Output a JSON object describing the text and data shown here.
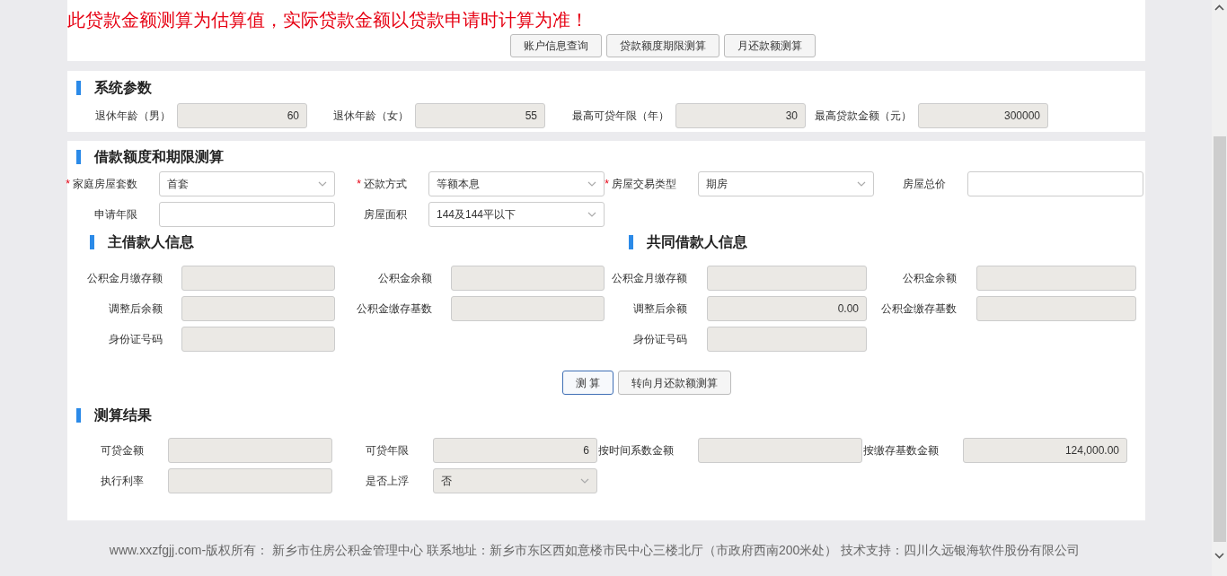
{
  "notice": "此贷款金额测算为估算值，实际贷款金额以贷款申请时计算为准！",
  "top_buttons": [
    "账户信息查询",
    "贷款额度期限测算",
    "月还款额测算"
  ],
  "system_params": {
    "title": "系统参数",
    "fields": [
      {
        "label": "退休年龄（男）",
        "kind": "input",
        "disabled": true,
        "value": "60"
      },
      {
        "label": "退休年龄（女）",
        "kind": "input",
        "disabled": true,
        "value": "55"
      },
      {
        "label": "最高可贷年限（年）",
        "kind": "input",
        "disabled": true,
        "value": "30"
      },
      {
        "label": "最高贷款金额（元）",
        "kind": "input",
        "disabled": true,
        "value": "300000"
      }
    ]
  },
  "loan_calc": {
    "title": "借款额度和期限测算",
    "fields": [
      {
        "label": "家庭房屋套数",
        "required_mark": "*",
        "kind": "select",
        "disabled": false,
        "value": "首套"
      },
      {
        "label": "还款方式",
        "required_mark": "*",
        "kind": "select",
        "disabled": false,
        "value": "等额本息"
      },
      {
        "label": "房屋交易类型",
        "required_mark": "*",
        "kind": "select",
        "disabled": false,
        "value": "期房"
      },
      {
        "label": "房屋总价",
        "kind": "input",
        "disabled": false
      },
      {
        "label": "申请年限",
        "kind": "input",
        "disabled": false
      },
      {
        "label": "房屋面积",
        "kind": "select",
        "disabled": false,
        "value": "144及144平以下"
      }
    ]
  },
  "main_borrower": {
    "title": "主借款人信息",
    "fields": [
      {
        "label": "公积金月缴存额",
        "kind": "input",
        "disabled": true
      },
      {
        "label": "公积金余额",
        "kind": "input",
        "disabled": true
      },
      {
        "label": "调整后余额",
        "kind": "input",
        "disabled": true
      },
      {
        "label": "公积金缴存基数",
        "kind": "input",
        "disabled": true
      },
      {
        "label": "身份证号码",
        "kind": "input",
        "disabled": true
      }
    ]
  },
  "co_borrower": {
    "title": "共同借款人信息",
    "fields": [
      {
        "label": "公积金月缴存额",
        "kind": "input",
        "disabled": true
      },
      {
        "label": "公积金余额",
        "kind": "input",
        "disabled": true
      },
      {
        "label": "调整后余额",
        "kind": "input",
        "disabled": true,
        "value": "0.00"
      },
      {
        "label": "公积金缴存基数",
        "kind": "input",
        "disabled": true
      },
      {
        "label": "身份证号码",
        "kind": "input",
        "disabled": true
      }
    ]
  },
  "actions": [
    {
      "label": "测 算",
      "focused": true
    },
    {
      "label": "转向月还款额测算",
      "focused": false
    }
  ],
  "results": {
    "title": "测算结果",
    "fields": [
      {
        "label": "可贷金额",
        "kind": "input",
        "disabled": true
      },
      {
        "label": "可贷年限",
        "kind": "input",
        "disabled": true,
        "value": "6"
      },
      {
        "label": "按时间系数金额",
        "kind": "input",
        "disabled": true
      },
      {
        "label": "按缴存基数金额",
        "kind": "input",
        "disabled": true,
        "value": "124,000.00"
      },
      {
        "label": "执行利率",
        "kind": "input",
        "disabled": true
      },
      {
        "label": "是否上浮",
        "kind": "select",
        "disabled": true,
        "value": "否"
      }
    ]
  },
  "footer": "www.xxzfgjj.com-版权所有： 新乡市住房公积金管理中心 联系地址：新乡市东区西如意楼市民中心三楼北厅（市政府西南200米处） 技术支持：四川久远银海软件股份有限公司"
}
